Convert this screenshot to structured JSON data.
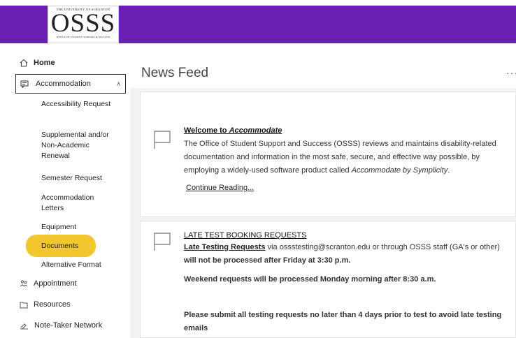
{
  "logo": {
    "university": "THE UNIVERSITY OF SCRANTON",
    "mark": "OSSS",
    "office": "OFFICE OF STUDENT SUPPORT & SUCCESS"
  },
  "colors": {
    "topbar": "#6a1fb3",
    "highlight": "#f2c72e"
  },
  "sidebar": {
    "home": "Home",
    "accommodation": "Accommodation",
    "sub_items": [
      "Accessibility Request",
      "Supplemental and/or Non-Academic Renewal",
      "Semester Request",
      "Accommodation Letters",
      "Equipment",
      "Documents",
      "Alternative Format"
    ],
    "appointment": "Appointment",
    "resources": "Resources",
    "note_taker": "Note-Taker Network"
  },
  "main": {
    "title": "News Feed",
    "more": "···"
  },
  "posts": [
    {
      "title_prefix": "Welcome to ",
      "title_em": "Accommodate",
      "body_1": "The Office of Student Support and Success (OSSS) reviews and maintains disability-related documentation and information in the most safe, secure, and effective way possible, by employing a widely-used software product called ",
      "body_em": "Accommodate by Symplicity",
      "body_end": ".",
      "link": "Continue Reading..."
    },
    {
      "title": "LATE TEST BOOKING REQUESTS",
      "lead_link": "Late Testing Requests",
      "line_1": " via ossstesting@scranton.edu or through OSSS staff (GA's or other) ",
      "line_1_bold": "will not be processed after Friday at 3:30 p.m.",
      "line_2": "Weekend requests will be processed Monday morning after 8:30 a.m.",
      "line_3": "Please submit all testing requests no later than 4 days prior to test to avoid late testing emails"
    }
  ]
}
